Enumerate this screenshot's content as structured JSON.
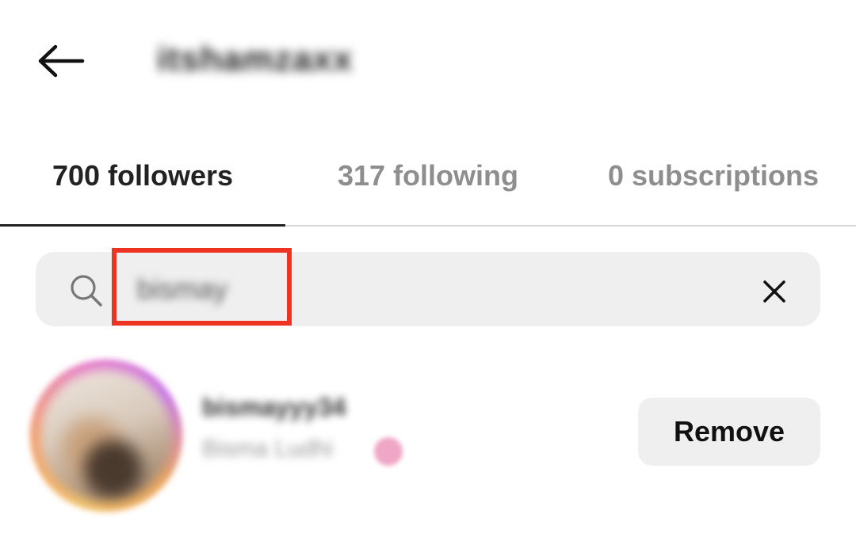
{
  "header": {
    "back_icon": "arrow-left-icon",
    "profile_name": "itshamzaxx"
  },
  "tabs": [
    {
      "label": "700 followers",
      "active": true
    },
    {
      "label": "317 following",
      "active": false
    },
    {
      "label": "0 subscriptions",
      "active": false
    }
  ],
  "search": {
    "icon": "search-icon",
    "value": "bismay",
    "clear_icon": "close-icon",
    "highlight_color": "#ee3322"
  },
  "results": [
    {
      "username": "bismayyy34",
      "full_name": "Bisma Ludhi",
      "action_label": "Remove"
    }
  ],
  "colors": {
    "background": "#ffffff",
    "active_text": "#222222",
    "inactive_text": "#8e8e8e",
    "search_bg": "#efefef"
  }
}
